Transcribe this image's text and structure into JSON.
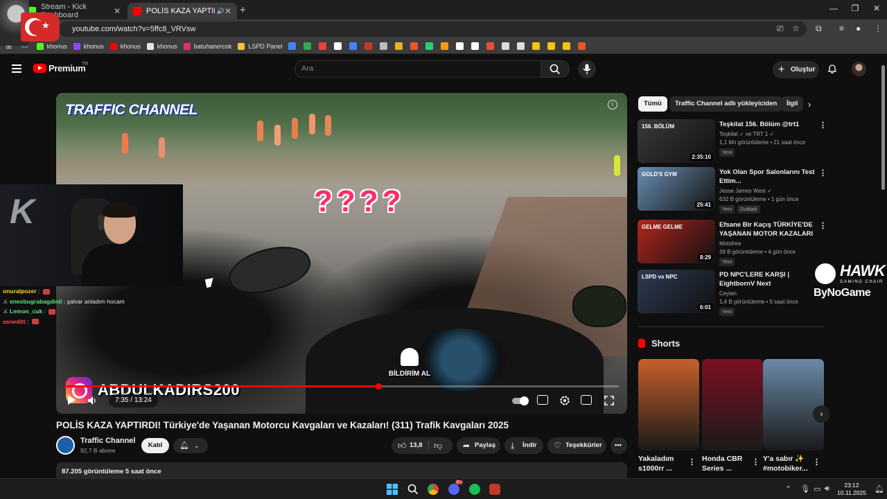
{
  "browser": {
    "tabs": [
      {
        "label": "Stream - Kick Dashboard",
        "active": false,
        "favicon_color": "#53fc18"
      },
      {
        "label": "POLİS KAZA YAPTIRDI! Türk",
        "active": true,
        "favicon_color": "#ff0000"
      }
    ],
    "url": "youtube.com/watch?v=5ffc8_VRVsw",
    "bookmarks": [
      {
        "label": "khonus",
        "icon_color": "#53fc18"
      },
      {
        "label": "khonus",
        "icon_color": "#9146ff"
      },
      {
        "label": "khonus",
        "icon_color": "#ff0000"
      },
      {
        "label": "khonus",
        "icon_color": "#e7e7e7"
      },
      {
        "label": "batuhanercok",
        "icon_color": "#e1306c"
      },
      {
        "label": "LSPD Panel",
        "icon_color": "#f4c542"
      }
    ],
    "bookmark_icons": [
      "#4285f4",
      "#34a853",
      "#ea4335",
      "#ffffff",
      "#4285f4",
      "#c0392b",
      "#bbbbbb",
      "#e6b422",
      "#e8562a",
      "#2ecc71",
      "#f39c12",
      "#ffffff",
      "#ffffff",
      "#e74c3c",
      "#dddddd",
      "#dddddd",
      "#f1c40f",
      "#f1c40f",
      "#f1c40f",
      "#e8562a"
    ]
  },
  "youtube": {
    "brand": "Premium",
    "brand_sup": "TR",
    "search_placeholder": "Ara",
    "create_label": "Oluştur"
  },
  "player": {
    "channel_watermark": "TRAFFIC CHANNEL",
    "overlay_marks": "????",
    "instagram_handle": "ABDULKADIRS200",
    "subscribe_bell_text": "BİLDİRİM AL",
    "time_display": "7:35 / 13:24",
    "progress": 0.566,
    "accent_color": "#ff0000"
  },
  "stream": {
    "chat": [
      {
        "user": "onuralpozer",
        "message": "",
        "user_color": "#ffd24a",
        "icon": ""
      },
      {
        "user": "enesbugrabagdinli",
        "message": "şalvar anladım hocam",
        "user_color": "#59e88a",
        "icon": "sword-icon"
      },
      {
        "user": "Lemon_cuk",
        "message": "",
        "user_color": "#59e88a",
        "icon": "sword-icon"
      },
      {
        "user": "asneditt",
        "message": "",
        "user_color": "#ff4d4d",
        "icon": ""
      }
    ]
  },
  "video": {
    "title": "POLİS KAZA YAPTIRDI! Türkiye'de Yaşanan Motorcu Kavgaları ve Kazaları! (311) Trafik Kavgaları 2025",
    "channel": "Traffic Channel",
    "subscribers": "92,7 B abone",
    "join_label": "Katıl",
    "likes": "13,8",
    "share_label": "Paylaş",
    "download_label": "İndir",
    "thanks_label": "Teşekkürler",
    "description_meta": "87.205 görüntüleme  5 saat önce"
  },
  "sidebar": {
    "chips": [
      {
        "label": "Tümü",
        "active": true
      },
      {
        "label": "Traffic Channel adlı yükleyiciden",
        "active": false
      },
      {
        "label": "İlgil",
        "active": false
      }
    ],
    "recommendations": [
      {
        "title": "Teşkilat 156. Bölüm @trt1",
        "channel": "Teşkilat ✓ ve TRT 1 ✓",
        "meta": "1,1 Mn görüntüleme • 21 saat önce",
        "duration": "2:35:10",
        "badge": "Yeni",
        "badge2": "",
        "thumb_color": "#3a3a3a",
        "thumb_label": "156. BÖLÜM"
      },
      {
        "title": "Yok Olan Spor Salonlarını Test Ettim...",
        "channel": "Jesse James West ✓",
        "meta": "632 B görüntüleme • 1 gün önce",
        "duration": "25:41",
        "badge": "Yeni",
        "badge2": "Dublajlı",
        "thumb_color": "#6a8fb4",
        "thumb_label": "GOLD'S GYM"
      },
      {
        "title": "Efsane Bir Kaçış TÜRKİYE'DE YAŞANAN MOTOR KAZALARI ...",
        "channel": "Motofree",
        "meta": "39 B görüntüleme • 4 gün önce",
        "duration": "8:29",
        "badge": "Yeni",
        "badge2": "",
        "thumb_color": "#b3261e",
        "thumb_label": "GELME GELME"
      },
      {
        "title": "PD NPC'LERE KARŞI | EightbornV Next",
        "channel": "Ceylan",
        "meta": "1,4 B görüntüleme • 5 saat önce",
        "duration": "6:01",
        "badge": "Yeni",
        "badge2": "",
        "thumb_color": "#2d3b55",
        "thumb_label": "LSPD vs NPC"
      }
    ],
    "shorts_heading": "Shorts",
    "shorts": [
      {
        "title": "Yakaladım s1000rr ...",
        "color": "#c7602a"
      },
      {
        "title": "Honda CBR Series ...",
        "color": "#7a1020"
      },
      {
        "title": "Y'a sabır ✨ #motobiker...",
        "color": "#6b8aa8"
      }
    ]
  },
  "sponsor": {
    "name": "HAWK",
    "tagline": "GAMING CHAIR",
    "by": "ByNoGame"
  },
  "taskbar": {
    "time": "23:12",
    "date": "10.11.2025",
    "discord_badge": "9+"
  }
}
